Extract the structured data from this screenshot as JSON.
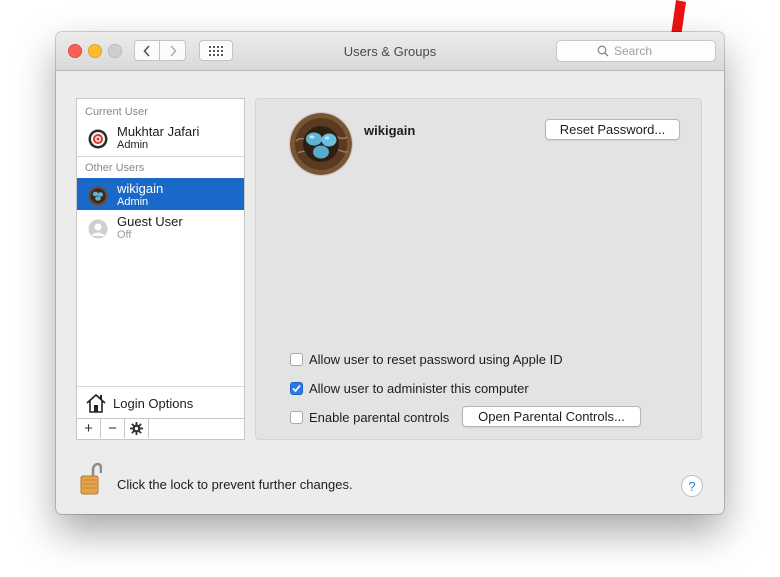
{
  "window": {
    "title": "Users & Groups"
  },
  "search": {
    "placeholder": "Search"
  },
  "sidebar": {
    "current_user_header": "Current User",
    "other_users_header": "Other Users",
    "users": [
      {
        "name": "Mukhtar Jafari",
        "role": "Admin"
      },
      {
        "name": "wikigain",
        "role": "Admin",
        "selected": true
      },
      {
        "name": "Guest User",
        "role": "Off"
      }
    ],
    "login_options_label": "Login Options",
    "add_label": "+",
    "remove_label": "−"
  },
  "panel": {
    "user_name": "wikigain",
    "reset_password_label": "Reset Password...",
    "options": [
      {
        "label": "Allow user to reset password using Apple ID",
        "checked": false
      },
      {
        "label": "Allow user to administer this computer",
        "checked": true
      },
      {
        "label": "Enable parental controls",
        "checked": false
      }
    ],
    "open_parental_label": "Open Parental Controls..."
  },
  "footer": {
    "lock_text": "Click the lock to prevent further changes.",
    "help_label": "?"
  },
  "colors": {
    "selection": "#1a68c8",
    "checkbox_on": "#2a7ae6",
    "annotation_arrow": "#ee1111"
  }
}
